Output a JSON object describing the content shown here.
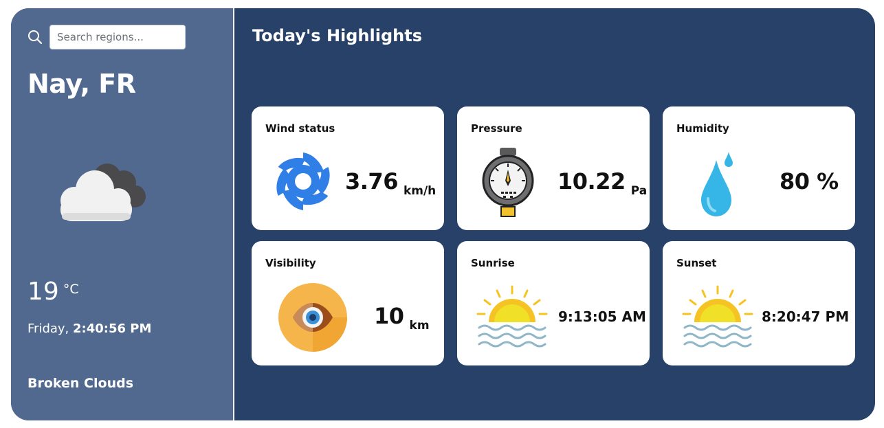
{
  "search": {
    "placeholder": "Search regions..."
  },
  "location": "Nay, FR",
  "current": {
    "temperature": "19",
    "unit": "°C",
    "day": "Friday,",
    "time": "2:40:56 PM",
    "condition": "Broken Clouds",
    "icon": "broken-clouds-icon"
  },
  "highlights": {
    "title": "Today's Highlights",
    "wind": {
      "label": "Wind status",
      "value": "3.76",
      "unit": "km/h",
      "icon": "wind-icon"
    },
    "pressure": {
      "label": "Pressure",
      "value": "10.22",
      "unit": "Pa",
      "icon": "pressure-gauge-icon"
    },
    "humidity": {
      "label": "Humidity",
      "value": "80 %",
      "icon": "water-drop-icon"
    },
    "visibility": {
      "label": "Visibility",
      "value": "10",
      "unit": "km",
      "icon": "eye-icon"
    },
    "sunrise": {
      "label": "Sunrise",
      "value": "9:13:05 AM",
      "icon": "sunrise-icon"
    },
    "sunset": {
      "label": "Sunset",
      "value": "8:20:47 PM",
      "icon": "sunset-icon"
    }
  },
  "colors": {
    "main_bg": "#284169",
    "sidebar_bg": "#52698f",
    "card_bg": "#ffffff",
    "wind_blue": "#2f7fe6",
    "drop_blue": "#36b6e6",
    "sun_yellow": "#f5c323"
  }
}
